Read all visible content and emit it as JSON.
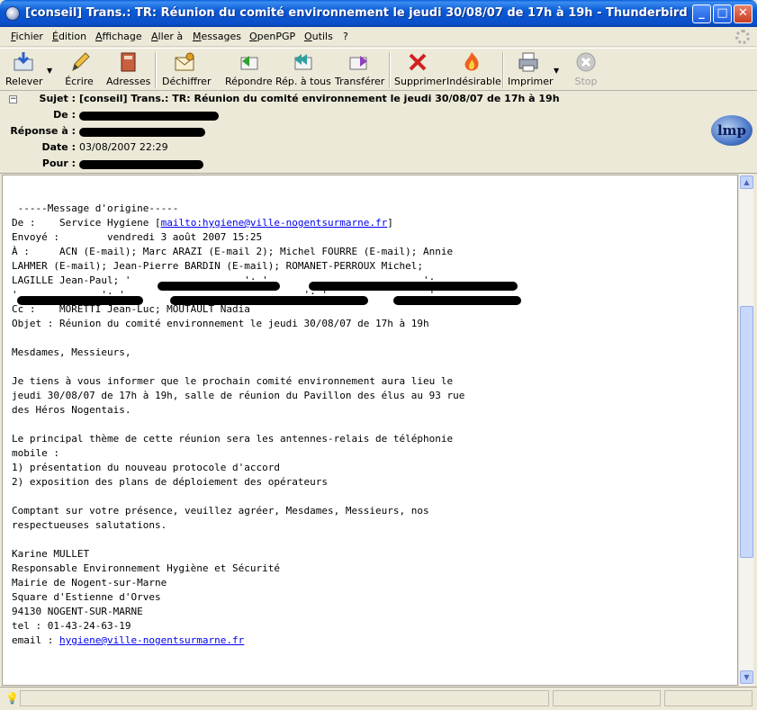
{
  "window": {
    "title": "[conseil] Trans.: TR: Réunion du comité environnement le jeudi 30/08/07 de 17h à 19h - Thunderbird",
    "min_glyph": "_",
    "max_glyph": "□",
    "close_glyph": "✕"
  },
  "menu": {
    "items": [
      "Fichier",
      "Édition",
      "Affichage",
      "Aller à",
      "Messages",
      "OpenPGP",
      "Outils",
      "?"
    ]
  },
  "toolbar": {
    "releve": "Relever",
    "ecrire": "Écrire",
    "adresses": "Adresses",
    "dechiffrer": "Déchiffrer",
    "repondre": "Répondre",
    "rep_tous": "Rép. à tous",
    "transferer": "Transférer",
    "supprimer": "Supprimer",
    "indesirable": "Indésirable",
    "imprimer": "Imprimer",
    "stop": "Stop"
  },
  "header": {
    "subject_label": "Sujet :",
    "subject": "[conseil] Trans.: TR: Réunion du comité environnement le jeudi 30/08/07 de 17h à 19h",
    "from_label": "De :",
    "reply_label": "Réponse à :",
    "date_label": "Date :",
    "date": "03/08/2007 22:29",
    "to_label": "Pour :",
    "logo_text": "lmp"
  },
  "message": {
    "l01": " -----Message d'origine-----",
    "l02_a": "De :    Service Hygiene [",
    "l02_link": "mailto:hygiene@ville-nogentsurmarne.fr",
    "l02_b": "]",
    "l03": "Envoyé :        vendredi 3 août 2007 15:25",
    "l04": "À :     ACN (E-mail); Marc ARAZI (E-mail 2); Michel FOURRE (E-mail); Annie",
    "l05": "LAHMER (E-mail); Jean-Pierre BARDIN (E-mail); ROMANET-PERROUX Michel;",
    "l06": "LAGILLE Jean-Paul; '                   '; '                          ';",
    "l07": "'              '; '                              '; '                 '",
    "l08": "Cc :    MORETTI Jean-Luc; MOUTAULT Nadia",
    "l09": "Objet : Réunion du comité environnement le jeudi 30/08/07 de 17h à 19h",
    "l10": "Mesdames, Messieurs,",
    "l11": "Je tiens à vous informer que le prochain comité environnement aura lieu le",
    "l12": "jeudi 30/08/07 de 17h à 19h, salle de réunion du Pavillon des élus au 93 rue",
    "l13": "des Héros Nogentais.",
    "l14": "Le principal thème de cette réunion sera les antennes-relais de téléphonie",
    "l15": "mobile :",
    "l16": "1) présentation du nouveau protocole d'accord",
    "l17": "2) exposition des plans de déploiement des opérateurs",
    "l18": "Comptant sur votre présence, veuillez agréer, Mesdames, Messieurs, nos",
    "l19": "respectueuses salutations.",
    "l20": "Karine MULLET",
    "l21": "Responsable Environnement Hygiène et Sécurité",
    "l22": "Mairie de Nogent-sur-Marne",
    "l23": "Square d'Estienne d'Orves",
    "l24": "94130 NOGENT-SUR-MARNE",
    "l25": "tel : 01-43-24-63-19",
    "l26_a": "email : ",
    "l26_link": "hygiene@ville-nogentsurmarne.fr"
  },
  "colors": {
    "titlebar": "#0b5ad6",
    "link": "#0000ee",
    "chrome": "#ece9d8"
  }
}
